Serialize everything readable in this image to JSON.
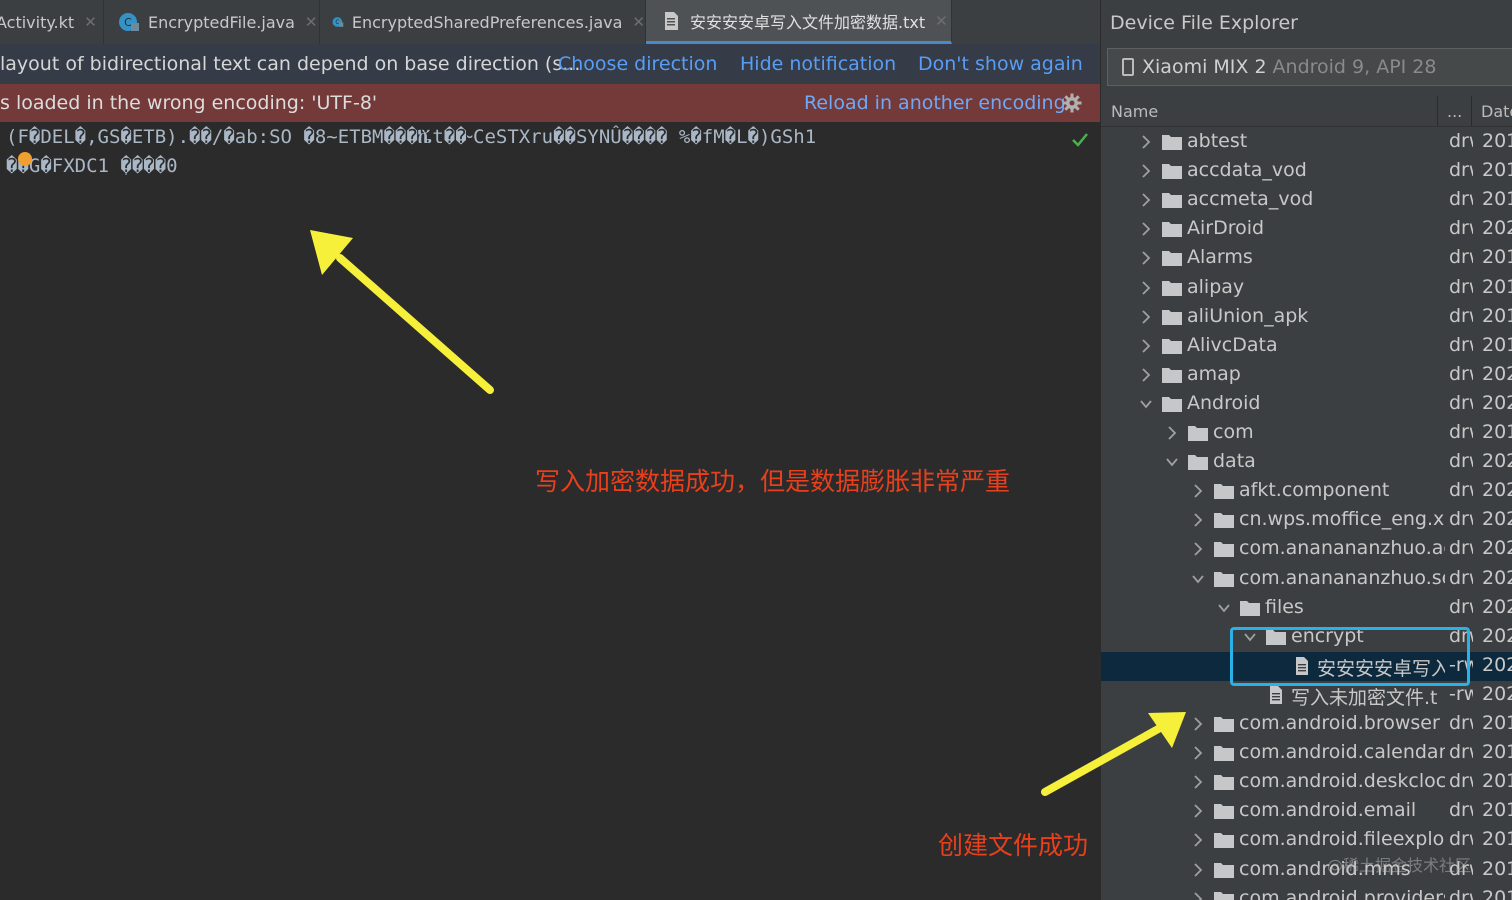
{
  "tabs": [
    {
      "label": "Activity.kt",
      "icon": "kotlin-file-icon"
    },
    {
      "label": "EncryptedFile.java",
      "icon": "java-class-icon"
    },
    {
      "label": "EncryptedSharedPreferences.java",
      "icon": "java-class-icon"
    },
    {
      "label": "安安安安卓写入文件加密数据.txt",
      "icon": "text-file-icon",
      "active": true
    }
  ],
  "notification_bidi": {
    "message": "layout of bidirectional text can depend on base direction (s...",
    "actions": [
      "Choose direction",
      "Hide notification",
      "Don't show again"
    ]
  },
  "notification_encoding": {
    "message": "s loaded in the wrong encoding: 'UTF-8'",
    "action": "Reload in another encoding"
  },
  "editor_lines": [
    "(F�DEL�,GS�ETB).��/�ab:SO �8~ETBM���ⷌt��⏑CeSTXru��SYNÛ���� %�fM�L�)GSh1",
    "��G�FXDC1 ֽ����0"
  ],
  "annotations": {
    "editor_note": "写入加密数据成功，但是数据膨胀非常严重",
    "explorer_note": "创建文件成功"
  },
  "explorer": {
    "title": "Device File Explorer",
    "device_name": "Xiaomi MIX 2",
    "device_version": "Android 9, API 28",
    "columns": {
      "name": "Name",
      "more": "...",
      "date": "Date"
    },
    "rows": [
      {
        "name": "abtest",
        "perm": "drw",
        "date": "201",
        "depth": 0,
        "type": "folder",
        "expanded": false
      },
      {
        "name": "accdata_vod",
        "perm": "drw",
        "date": "201",
        "depth": 0,
        "type": "folder",
        "expanded": false
      },
      {
        "name": "accmeta_vod",
        "perm": "drw",
        "date": "201",
        "depth": 0,
        "type": "folder",
        "expanded": false
      },
      {
        "name": "AirDroid",
        "perm": "drw",
        "date": "202",
        "depth": 0,
        "type": "folder",
        "expanded": false
      },
      {
        "name": "Alarms",
        "perm": "drw",
        "date": "201",
        "depth": 0,
        "type": "folder",
        "expanded": false
      },
      {
        "name": "alipay",
        "perm": "drw",
        "date": "201",
        "depth": 0,
        "type": "folder",
        "expanded": false
      },
      {
        "name": "aliUnion_apk",
        "perm": "drw",
        "date": "201",
        "depth": 0,
        "type": "folder",
        "expanded": false
      },
      {
        "name": "AlivcData",
        "perm": "drw",
        "date": "201",
        "depth": 0,
        "type": "folder",
        "expanded": false
      },
      {
        "name": "amap",
        "perm": "drw",
        "date": "202",
        "depth": 0,
        "type": "folder",
        "expanded": false
      },
      {
        "name": "Android",
        "perm": "drw",
        "date": "202",
        "depth": 0,
        "type": "folder",
        "expanded": true
      },
      {
        "name": "com",
        "perm": "drw",
        "date": "201",
        "depth": 1,
        "type": "folder",
        "expanded": false
      },
      {
        "name": "data",
        "perm": "drw",
        "date": "202",
        "depth": 1,
        "type": "folder",
        "expanded": true
      },
      {
        "name": "afkt.component",
        "perm": "drw",
        "date": "202",
        "depth": 2,
        "type": "folder",
        "expanded": false
      },
      {
        "name": "cn.wps.moffice_eng.xi",
        "perm": "drw",
        "date": "202",
        "depth": 2,
        "type": "folder",
        "expanded": false
      },
      {
        "name": "com.ananananzhuo.ac",
        "perm": "drw",
        "date": "202",
        "depth": 2,
        "type": "folder",
        "expanded": false
      },
      {
        "name": "com.ananananzhuo.se",
        "perm": "drw",
        "date": "202",
        "depth": 2,
        "type": "folder",
        "expanded": true
      },
      {
        "name": "files",
        "perm": "drw",
        "date": "202",
        "depth": 3,
        "type": "folder",
        "expanded": true
      },
      {
        "name": "encrypt",
        "perm": "drw",
        "date": "202",
        "depth": 4,
        "type": "folder",
        "expanded": true
      },
      {
        "name": "安安安安卓写入",
        "perm": "-rw",
        "date": "202",
        "depth": 5,
        "type": "file",
        "selected": true
      },
      {
        "name": "写入未加密文件.t",
        "perm": "-rw",
        "date": "202",
        "depth": 4,
        "type": "file"
      },
      {
        "name": "com.android.browser",
        "perm": "drw",
        "date": "201",
        "depth": 2,
        "type": "folder",
        "expanded": false
      },
      {
        "name": "com.android.calendar",
        "perm": "drw",
        "date": "201",
        "depth": 2,
        "type": "folder",
        "expanded": false
      },
      {
        "name": "com.android.deskclock",
        "perm": "drw",
        "date": "201",
        "depth": 2,
        "type": "folder",
        "expanded": false
      },
      {
        "name": "com.android.email",
        "perm": "drw",
        "date": "201",
        "depth": 2,
        "type": "folder",
        "expanded": false
      },
      {
        "name": "com.android.fileexplor",
        "perm": "drw",
        "date": "201",
        "depth": 2,
        "type": "folder",
        "expanded": false
      },
      {
        "name": "com.android.mms",
        "perm": "drw",
        "date": "201",
        "depth": 2,
        "type": "folder",
        "expanded": false
      },
      {
        "name": "com.android.providers",
        "perm": "drw",
        "date": "201",
        "depth": 2,
        "type": "folder",
        "expanded": false
      }
    ]
  },
  "watermark": "@稀土掘金技术社区",
  "colors": {
    "editor_bg": "#2b2b2b",
    "panel_bg": "#3c3f41",
    "link": "#589df6",
    "error_banner": "#743a3a",
    "selection": "#0d293e",
    "annotation_text": "#e8401c",
    "arrow": "#f7f03a",
    "highlight_box": "#2ab1e8"
  }
}
